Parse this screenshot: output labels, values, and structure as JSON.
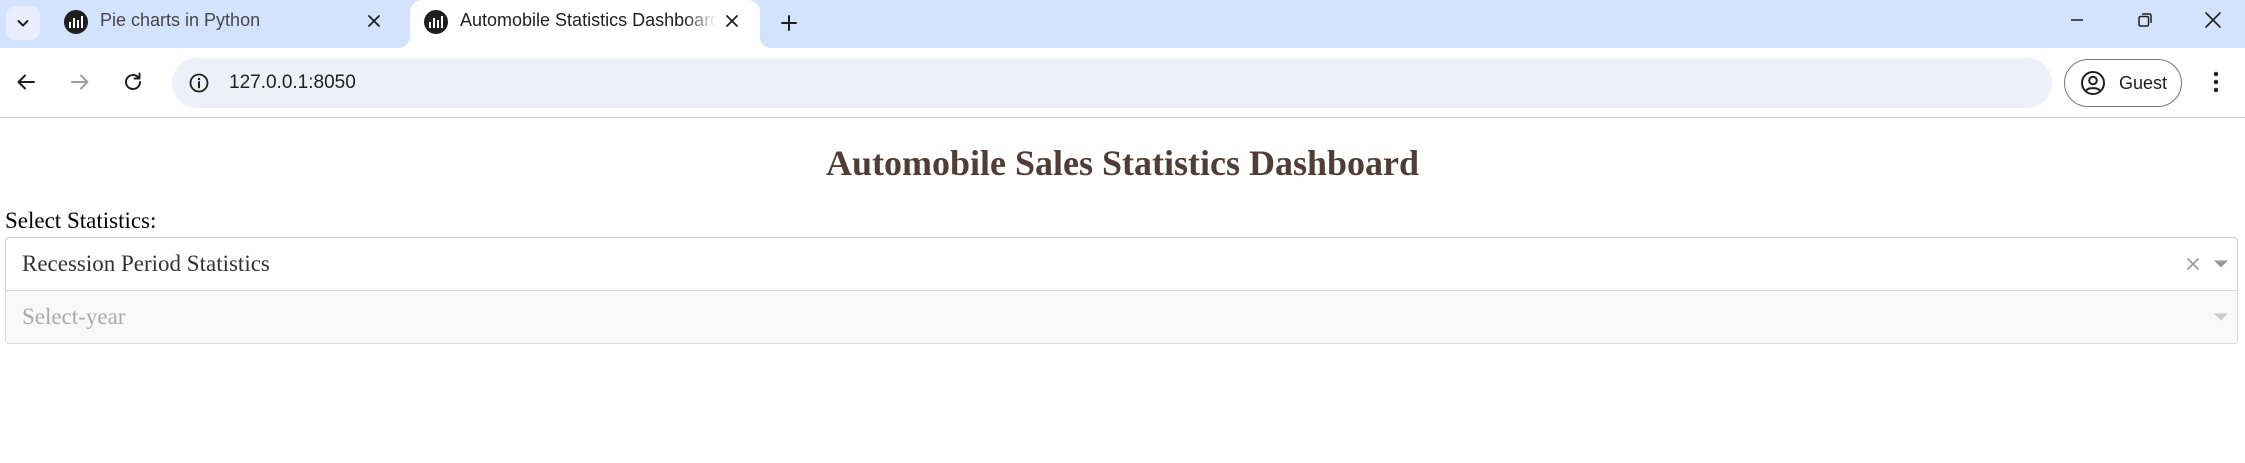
{
  "browser": {
    "tabs": [
      {
        "title": "Pie charts in Python",
        "active": false,
        "icon": "dash-favicon-icon"
      },
      {
        "title": "Automobile Statistics Dashboard",
        "active": true,
        "icon": "dash-favicon-icon"
      }
    ],
    "address": {
      "url": "127.0.0.1:8050"
    },
    "profile": {
      "label": "Guest"
    },
    "colors": {
      "tab_strip": "#d3e3fd",
      "omnibox": "#edf0f9"
    }
  },
  "page": {
    "title": "Automobile Sales Statistics Dashboard",
    "title_color": "#503d36",
    "statistics_label": "Select Statistics:",
    "statistics_dropdown": {
      "value": "Recession Period Statistics",
      "clearable": true
    },
    "year_dropdown": {
      "placeholder": "Select-year",
      "disabled": true
    }
  }
}
